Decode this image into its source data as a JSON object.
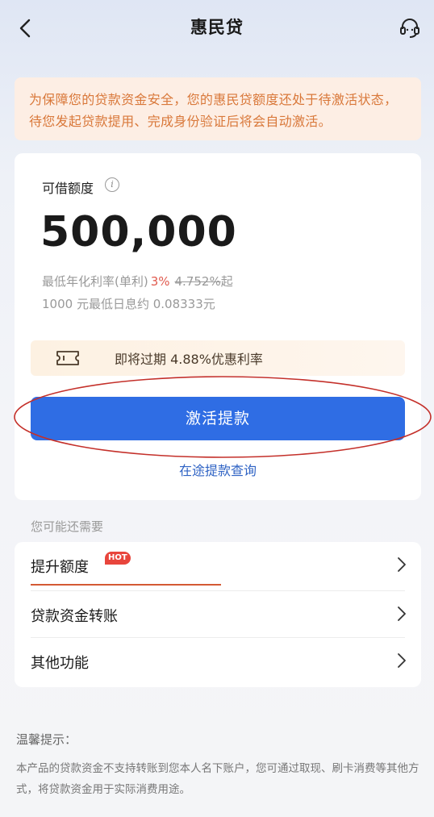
{
  "header": {
    "title": "惠民贷",
    "back_icon": "back-arrow-icon",
    "service_icon": "customer-service-icon"
  },
  "notice": {
    "text": "为保障您的贷款资金安全，您的惠民贷额度还处于待激活状态，待您发起贷款提用、完成身份验证后将会自动激活。"
  },
  "credit": {
    "label": "可借额度",
    "info_glyph": "i",
    "amount": "500,000",
    "rate_prefix": "最低年化利率(单利)",
    "rate_value": "3%",
    "rate_old": "4.752%",
    "rate_suffix": "起",
    "interest_text": "1000 元最低日息约 0.08333元"
  },
  "coupon": {
    "icon": "ticket-icon",
    "text": "即将过期 4.88%优惠利率"
  },
  "actions": {
    "activate_label": "激活提款",
    "query_label": "在途提款查询"
  },
  "section": {
    "title": "您可能还需要",
    "items": [
      {
        "label": "提升额度",
        "badge": "HOT"
      },
      {
        "label": "贷款资金转账"
      },
      {
        "label": "其他功能"
      }
    ]
  },
  "tips": {
    "title": "温馨提示：",
    "text": "本产品的贷款资金不支持转账到您本人名下账户，您可通过取现、刷卡消费等其他方式，将贷款资金用于实际消费用途。"
  },
  "colors": {
    "accent": "#2f6de4",
    "notice_text": "#d9783a",
    "rate_red": "#e05a4e",
    "hot_badge": "#e8453c"
  }
}
